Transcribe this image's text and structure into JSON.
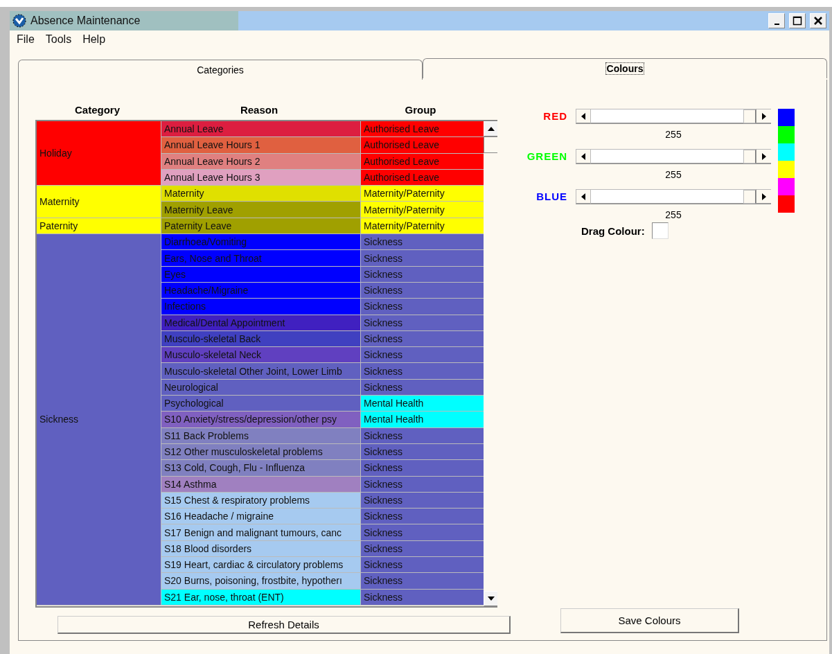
{
  "window": {
    "title": "Absence Maintenance"
  },
  "menu": [
    "File",
    "Tools",
    "Help"
  ],
  "tabs": [
    {
      "label": "Categories",
      "selected": false
    },
    {
      "label": "Colours",
      "selected": true
    }
  ],
  "table": {
    "columns": [
      "Category",
      "Reason",
      "Group"
    ],
    "categories": [
      {
        "name": "Holiday",
        "color": "#ff0000",
        "rows": [
          {
            "reason": {
              "text": "Annual Leave",
              "color": "#dc1e40"
            },
            "group": {
              "text": "Authorised Leave",
              "color": "#ff0000"
            }
          },
          {
            "reason": {
              "text": "Annual Leave Hours 1",
              "color": "#e06040"
            },
            "group": {
              "text": "Authorised Leave",
              "color": "#ff0000"
            }
          },
          {
            "reason": {
              "text": "Annual Leave Hours 2",
              "color": "#e08080"
            },
            "group": {
              "text": "Authorised Leave",
              "color": "#ff0000"
            }
          },
          {
            "reason": {
              "text": "Annual Leave Hours 3",
              "color": "#e0a0c0"
            },
            "group": {
              "text": "Authorised Leave",
              "color": "#ff0000"
            }
          }
        ]
      },
      {
        "name": "Maternity",
        "color": "#ffff00",
        "rows": [
          {
            "reason": {
              "text": "Maternity",
              "color": "#e0e000"
            },
            "group": {
              "text": "Maternity/Paternity",
              "color": "#ffff00"
            }
          },
          {
            "reason": {
              "text": "Maternity Leave",
              "color": "#a0a000"
            },
            "group": {
              "text": "Maternity/Paternity",
              "color": "#ffff00"
            }
          }
        ]
      },
      {
        "name": "Paternity",
        "color": "#ffff00",
        "rows": [
          {
            "reason": {
              "text": "Paternity Leave",
              "color": "#a0a000"
            },
            "group": {
              "text": "Maternity/Paternity",
              "color": "#ffff00"
            }
          }
        ]
      },
      {
        "name": "Sickness",
        "color": "#6060c0",
        "rows": [
          {
            "reason": {
              "text": "Diarrhoea/Vomiting",
              "color": "#0000ff"
            },
            "group": {
              "text": "Sickness",
              "color": "#6060c0"
            }
          },
          {
            "reason": {
              "text": "Ears, Nose and Throat",
              "color": "#0000ff"
            },
            "group": {
              "text": "Sickness",
              "color": "#6060c0"
            }
          },
          {
            "reason": {
              "text": "Eyes",
              "color": "#0000ff"
            },
            "group": {
              "text": "Sickness",
              "color": "#6060c0"
            }
          },
          {
            "reason": {
              "text": "Headache/Migraine",
              "color": "#0000ff"
            },
            "group": {
              "text": "Sickness",
              "color": "#6060c0"
            }
          },
          {
            "reason": {
              "text": "Infections",
              "color": "#0000ff"
            },
            "group": {
              "text": "Sickness",
              "color": "#6060c0"
            }
          },
          {
            "reason": {
              "text": "Medical/Dental Appointment",
              "color": "#4020c0"
            },
            "group": {
              "text": "Sickness",
              "color": "#6060c0"
            }
          },
          {
            "reason": {
              "text": "Musculo-skeletal Back",
              "color": "#4040c0"
            },
            "group": {
              "text": "Sickness",
              "color": "#6060c0"
            }
          },
          {
            "reason": {
              "text": "Musculo-skeletal Neck",
              "color": "#6040c0"
            },
            "group": {
              "text": "Sickness",
              "color": "#6060c0"
            }
          },
          {
            "reason": {
              "text": "Musculo-skeletal Other Joint, Lower Limb",
              "color": "#6060c0"
            },
            "group": {
              "text": "Sickness",
              "color": "#6060c0"
            }
          },
          {
            "reason": {
              "text": "Neurological",
              "color": "#6060c0"
            },
            "group": {
              "text": "Sickness",
              "color": "#6060c0"
            }
          },
          {
            "reason": {
              "text": "Psychological",
              "color": "#6060c0"
            },
            "group": {
              "text": "Mental Health",
              "color": "#00ffff"
            }
          },
          {
            "reason": {
              "text": "S10 Anxiety/stress/depression/other psy",
              "color": "#8060c0"
            },
            "group": {
              "text": "Mental Health",
              "color": "#00ffff"
            }
          },
          {
            "reason": {
              "text": "S11 Back Problems",
              "color": "#8080c0"
            },
            "group": {
              "text": "Sickness",
              "color": "#6060c0"
            }
          },
          {
            "reason": {
              "text": "S12 Other musculoskeletal problems",
              "color": "#8080c0"
            },
            "group": {
              "text": "Sickness",
              "color": "#6060c0"
            }
          },
          {
            "reason": {
              "text": "S13 Cold, Cough, Flu - Influenza",
              "color": "#8080c0"
            },
            "group": {
              "text": "Sickness",
              "color": "#6060c0"
            }
          },
          {
            "reason": {
              "text": "S14 Asthma",
              "color": "#a080c0"
            },
            "group": {
              "text": "Sickness",
              "color": "#6060c0"
            }
          },
          {
            "reason": {
              "text": "S15 Chest & respiratory problems",
              "color": "#a6caf0"
            },
            "group": {
              "text": "Sickness",
              "color": "#6060c0"
            }
          },
          {
            "reason": {
              "text": "S16 Headache / migraine",
              "color": "#a6caf0"
            },
            "group": {
              "text": "Sickness",
              "color": "#6060c0"
            }
          },
          {
            "reason": {
              "text": "S17 Benign and malignant tumours, canc",
              "color": "#a6caf0"
            },
            "group": {
              "text": "Sickness",
              "color": "#6060c0"
            }
          },
          {
            "reason": {
              "text": "S18 Blood disorders",
              "color": "#a6caf0"
            },
            "group": {
              "text": "Sickness",
              "color": "#6060c0"
            }
          },
          {
            "reason": {
              "text": "S19 Heart, cardiac & circulatory problems",
              "color": "#a6caf0"
            },
            "group": {
              "text": "Sickness",
              "color": "#6060c0"
            }
          },
          {
            "reason": {
              "text": "S20 Burns, poisoning, frostbite, hypotherı",
              "color": "#a6caf0"
            },
            "group": {
              "text": "Sickness",
              "color": "#6060c0"
            }
          },
          {
            "reason": {
              "text": "S21 Ear, nose, throat (ENT)",
              "color": "#00ffff"
            },
            "group": {
              "text": "Sickness",
              "color": "#6060c0"
            }
          }
        ]
      }
    ]
  },
  "refresh_button": "Refresh Details",
  "sliders": [
    {
      "label": "RED",
      "color": "#ff0000",
      "level": 1,
      "reading": "255"
    },
    {
      "label": "GREEN",
      "color": "#00ff00",
      "level": 1,
      "reading": "255"
    },
    {
      "label": "BLUE",
      "color": "#0000ff",
      "level": 1,
      "reading": "255"
    }
  ],
  "swatches": [
    {
      "color": "#0000ff"
    },
    {
      "color": "#00ff00"
    },
    {
      "color": "#00ffff"
    },
    {
      "color": "#ffff00"
    },
    {
      "color": "#ff00ff"
    },
    {
      "color": "#ff0000"
    }
  ],
  "drag_colour": {
    "label": "Drag Colour:"
  },
  "save_button": "Save Colours"
}
